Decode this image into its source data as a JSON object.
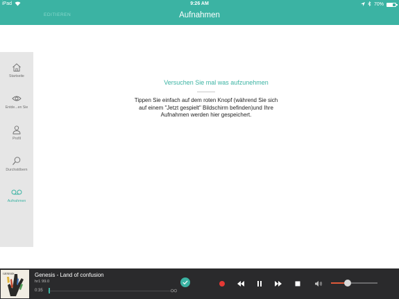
{
  "status_bar": {
    "carrier": "iPad",
    "time": "9:26 AM",
    "battery": "70%",
    "battery_level": 0.7
  },
  "header": {
    "edit_label": "EDITIEREN",
    "title": "Aufnahmen"
  },
  "sidebar": {
    "items": [
      {
        "label": "Startseite",
        "icon": "home-icon"
      },
      {
        "label": "Entde...en Sie",
        "icon": "eye-icon"
      },
      {
        "label": "Profil",
        "icon": "person-icon"
      },
      {
        "label": "Durchstöbern",
        "icon": "search-icon"
      },
      {
        "label": "Aufnahmen",
        "icon": "voicemail-icon",
        "active": true
      }
    ]
  },
  "empty_state": {
    "title": "Versuchen Sie mal was aufzunehmen",
    "text": "Tippen Sie einfach auf dem roten Knopf (während Sie sich auf einem \"Jetzt gespielt\" Bildschirm befinden)und Ihre Aufnahmen werden hier gespeichert."
  },
  "player": {
    "track": "Genesis - Land of confusion",
    "station": "hr1 99.0",
    "elapsed": "0:35",
    "volume_level": 0.35,
    "colors": {
      "accent": "#3bb3a3",
      "record": "#e53935"
    }
  }
}
